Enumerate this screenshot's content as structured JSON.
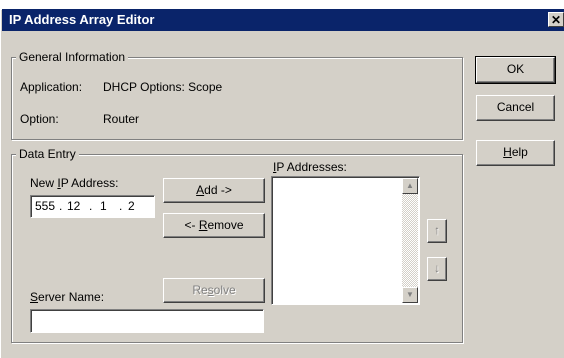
{
  "window": {
    "title": "IP Address Array Editor",
    "close_glyph": "✕"
  },
  "general": {
    "legend": "General Information",
    "application_label": "Application:",
    "application_value": "DHCP Options: Scope",
    "option_label": "Option:",
    "option_value": "Router"
  },
  "data_entry": {
    "legend": "Data Entry",
    "new_ip_label": {
      "pre": "New ",
      "key": "I",
      "post": "P Address:"
    },
    "ip_octets": [
      "555",
      "12",
      "1",
      "2"
    ],
    "ip_dots": [
      ".",
      ".",
      "."
    ],
    "add_button": {
      "key": "A",
      "post": "dd ->"
    },
    "remove_button": {
      "pre": "<- ",
      "key": "R",
      "post": "emove"
    },
    "server_name_label": {
      "key": "S",
      "post": "erver Name:"
    },
    "server_name_value": "",
    "resolve_button": {
      "pre": "Re",
      "key": "s",
      "post": "olve"
    },
    "ip_list_label": {
      "key": "I",
      "post": "P Addresses:"
    },
    "ip_list_items": []
  },
  "buttons": {
    "ok": "OK",
    "cancel": "Cancel",
    "help": {
      "key": "H",
      "post": "elp"
    }
  },
  "icons": {
    "move_up": "up-arrow-icon",
    "move_down": "down-arrow-icon",
    "scroll_up": "scroll-up-icon",
    "scroll_down": "scroll-down-icon"
  }
}
